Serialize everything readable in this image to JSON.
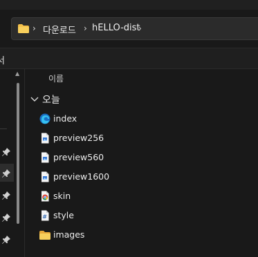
{
  "address_bar": {
    "breadcrumbs": [
      "다운로드",
      "hELLO-dist"
    ],
    "folder_icon": "folder-icon",
    "separator_icon": "chevron-right-icon"
  },
  "toolbar": {
    "partial_label": "서"
  },
  "content": {
    "column_header": "이름",
    "group": {
      "label": "오늘",
      "icon": "chevron-down-icon"
    },
    "files": [
      {
        "name": "index",
        "icon": "edge-html-icon"
      },
      {
        "name": "preview256",
        "icon": "image-file-icon"
      },
      {
        "name": "preview560",
        "icon": "image-file-icon"
      },
      {
        "name": "preview1600",
        "icon": "image-file-icon"
      },
      {
        "name": "skin",
        "icon": "chrome-file-icon"
      },
      {
        "name": "style",
        "icon": "css-file-icon"
      },
      {
        "name": "images",
        "icon": "folder-icon"
      }
    ]
  },
  "nav_pane": {
    "pinned_items": 5,
    "pin_icon": "pin-icon"
  },
  "colors": {
    "background": "#191919",
    "folder": "#f3c04a",
    "file_accent": "#3a7bd5"
  }
}
